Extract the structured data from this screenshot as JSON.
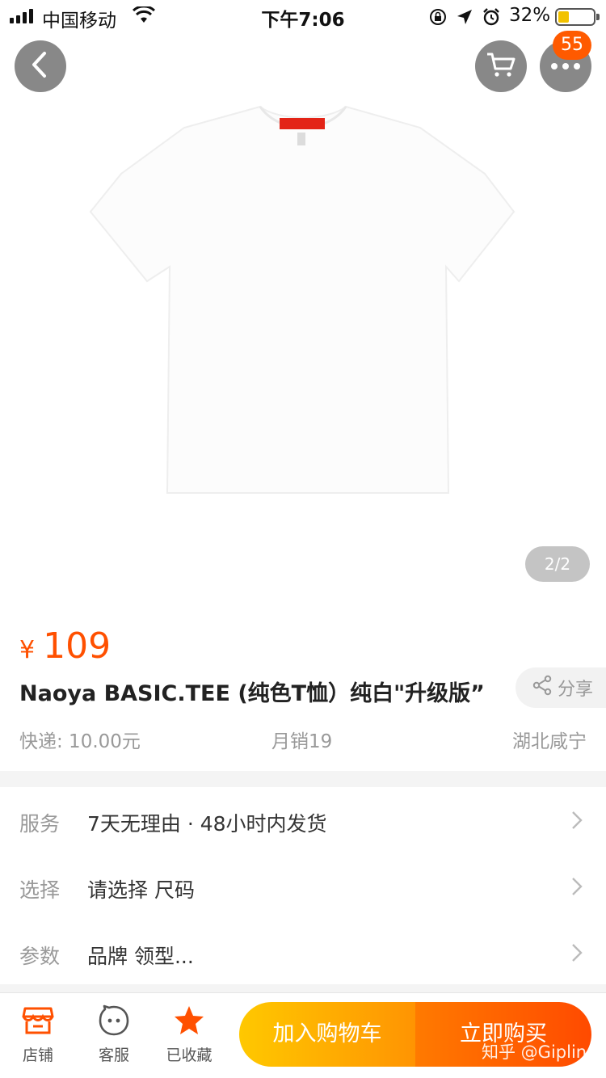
{
  "status_bar": {
    "carrier": "中国移动",
    "time": "下午7:06",
    "battery_percent": "32%",
    "battery_level": 0.32
  },
  "header": {
    "badge_count": "55"
  },
  "gallery": {
    "counter": "2/2"
  },
  "product": {
    "currency_symbol": "¥",
    "price": "109",
    "title": "Naoya BASIC.TEE (纯色T恤）纯白\"升级版”",
    "share_label": "分享",
    "shipping": "快递: 10.00元",
    "sales": "月销19",
    "location": "湖北咸宁"
  },
  "info_rows": [
    {
      "label": "服务",
      "value": "7天无理由 · 48小时内发货"
    },
    {
      "label": "选择",
      "value": "请选择 尺码"
    },
    {
      "label": "参数",
      "value": "品牌 领型..."
    }
  ],
  "bottom_bar": {
    "shop_label": "店铺",
    "service_label": "客服",
    "favorite_label": "已收藏",
    "add_to_cart_label": "加入购物车",
    "buy_now_label": "立即购买",
    "watermark": "知乎 @Giplin"
  },
  "colors": {
    "accent": "#ff5000",
    "cart_gradient": [
      "#ffc800",
      "#ff9402"
    ],
    "buy_gradient": [
      "#ff7a00",
      "#ff4a00"
    ]
  }
}
